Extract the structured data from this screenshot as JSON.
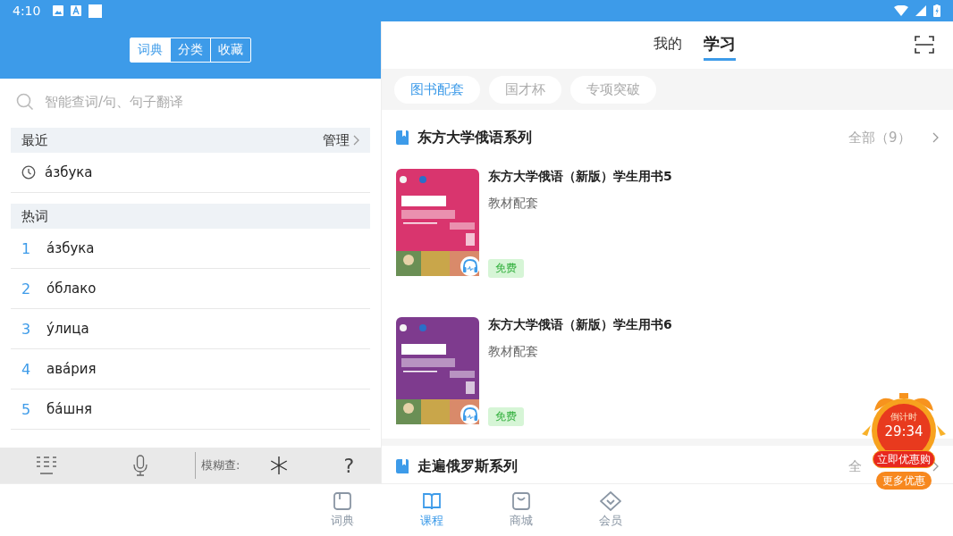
{
  "status_bar": {
    "time": "4:10"
  },
  "segments": [
    {
      "label": "词典",
      "selected": true
    },
    {
      "label": "分类",
      "selected": false
    },
    {
      "label": "收藏",
      "selected": false
    }
  ],
  "search": {
    "placeholder": "智能查词/句、句子翻译"
  },
  "recent": {
    "title": "最近",
    "action": "管理",
    "items": [
      "а́збука"
    ]
  },
  "hot": {
    "title": "热词",
    "items": [
      {
        "rank": "1",
        "word": "а́збука"
      },
      {
        "rank": "2",
        "word": "о́блако"
      },
      {
        "rank": "3",
        "word": "у́лица"
      },
      {
        "rank": "4",
        "word": "ава́рия"
      },
      {
        "rank": "5",
        "word": "ба́шня"
      }
    ]
  },
  "toolbar": {
    "fuzzy_label": "模糊查:",
    "help": "?"
  },
  "top_tabs": [
    {
      "label": "我的",
      "selected": false
    },
    {
      "label": "学习",
      "selected": true
    }
  ],
  "chips": [
    {
      "label": "图书配套",
      "selected": true
    },
    {
      "label": "国才杯",
      "selected": false
    },
    {
      "label": "专项突破",
      "selected": false
    }
  ],
  "sections": [
    {
      "title": "东方大学俄语系列",
      "more": "全部（9）",
      "books": [
        {
          "title": "东方大学俄语（新版）学生用书5",
          "subtitle": "教材配套",
          "badge": "免费",
          "color": "#d9356e"
        },
        {
          "title": "东方大学俄语（新版）学生用书6",
          "subtitle": "教材配套",
          "badge": "免费",
          "color": "#7e3b8e"
        }
      ]
    },
    {
      "title": "走遍俄罗斯系列",
      "more": "全"
    }
  ],
  "promo": {
    "label": "倒计时",
    "time": "29:34",
    "buy": "立即优惠购",
    "more": "更多优惠"
  },
  "nav": [
    {
      "label": "词典",
      "kind": "dictionary",
      "selected": false
    },
    {
      "label": "课程",
      "kind": "course",
      "selected": true
    },
    {
      "label": "商城",
      "kind": "shop",
      "selected": false
    },
    {
      "label": "会员",
      "kind": "vip",
      "selected": false
    }
  ]
}
